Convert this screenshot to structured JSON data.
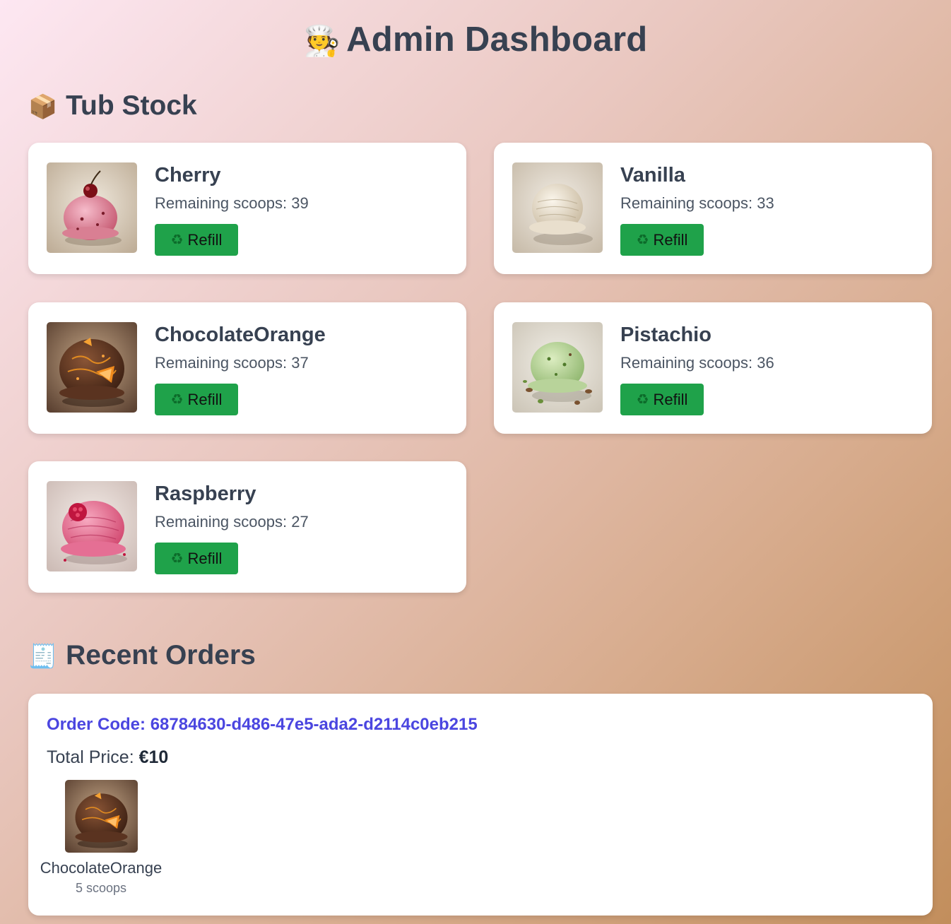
{
  "header": {
    "title_icon": "chef-emoji",
    "title": "Admin Dashboard"
  },
  "tub_stock": {
    "icon": "package-emoji",
    "title": "Tub Stock",
    "remaining_prefix": "Remaining scoops: ",
    "refill_icon": "recycle-icon",
    "refill_label": "Refill",
    "flavors": [
      {
        "name": "Cherry",
        "remaining": 39,
        "image": "cherry-ice-cream-image"
      },
      {
        "name": "Vanilla",
        "remaining": 33,
        "image": "vanilla-ice-cream-image"
      },
      {
        "name": "ChocolateOrange",
        "remaining": 37,
        "image": "chocolate-orange-ice-cream-image"
      },
      {
        "name": "Pistachio",
        "remaining": 36,
        "image": "pistachio-ice-cream-image"
      },
      {
        "name": "Raspberry",
        "remaining": 27,
        "image": "raspberry-ice-cream-image"
      }
    ]
  },
  "recent_orders": {
    "icon": "receipt-emoji",
    "title": "Recent Orders",
    "orders": [
      {
        "code_label": "Order Code: ",
        "code": "68784630-d486-47e5-ada2-d2114c0eb215",
        "total_label": "Total Price: ",
        "total": "€10",
        "items": [
          {
            "name": "ChocolateOrange",
            "scoops": "5 scoops",
            "image": "chocolate-orange-ice-cream-image"
          }
        ]
      }
    ]
  },
  "colors": {
    "refill_button": "#1fa24a",
    "order_code": "#4b46e0",
    "heading_text": "#374151"
  }
}
